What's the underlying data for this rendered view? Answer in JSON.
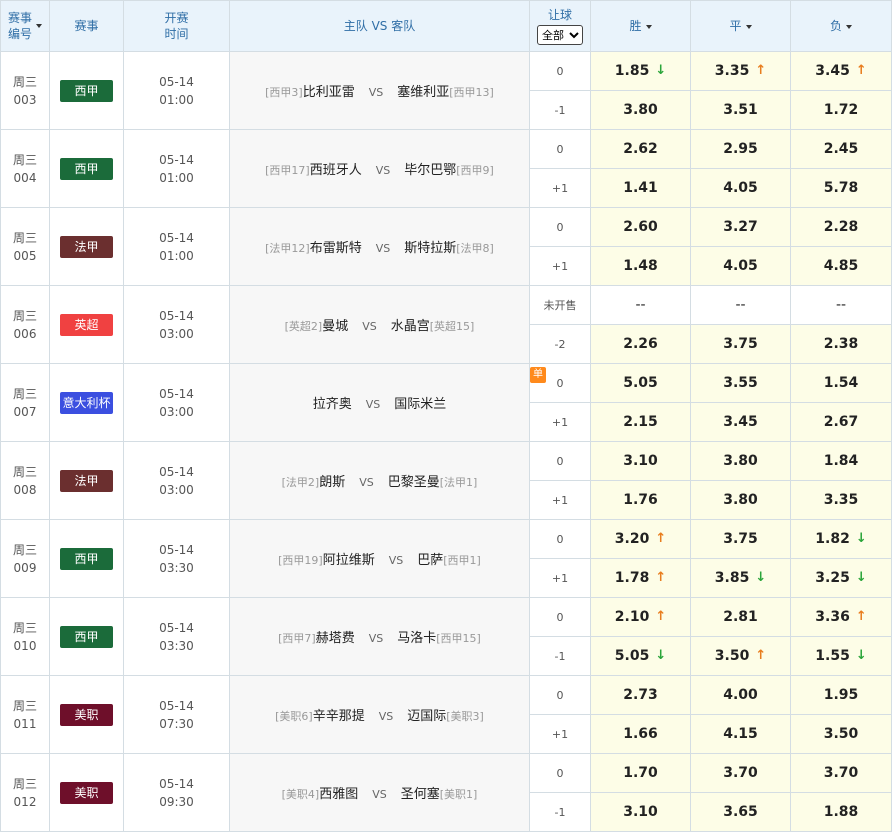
{
  "header": {
    "match_no": "赛事\n编号",
    "match_no_l1": "赛事",
    "match_no_l2": "编号",
    "league": "赛事",
    "time_l1": "开赛",
    "time_l2": "时间",
    "teams": "主队 VS 客队",
    "handicap_label": "让球",
    "handicap_select": "全部",
    "win": "胜",
    "draw": "平",
    "lose": "负"
  },
  "colors": {
    "西甲": "#1b6b3a",
    "法甲": "#6b2f2f",
    "英超": "#f04141",
    "意大利杯": "#3b4fe0",
    "美职": "#6e0f2a"
  },
  "matches": [
    {
      "weekday": "周三",
      "no": "003",
      "league": "西甲",
      "date": "05-14",
      "time": "01:00",
      "home_rank": "[西甲3]",
      "home": "比利亚雷",
      "vs": "VS",
      "away": "塞维利亚",
      "away_rank": "[西甲13]",
      "single": "",
      "rows": [
        {
          "hc": "0",
          "w": "1.85",
          "wa": "down",
          "d": "3.35",
          "da": "up",
          "l": "3.45",
          "la": "up"
        },
        {
          "hc": "-1",
          "w": "3.80",
          "wa": "",
          "d": "3.51",
          "da": "",
          "l": "1.72",
          "la": ""
        }
      ]
    },
    {
      "weekday": "周三",
      "no": "004",
      "league": "西甲",
      "date": "05-14",
      "time": "01:00",
      "home_rank": "[西甲17]",
      "home": "西班牙人",
      "vs": "VS",
      "away": "毕尔巴鄂",
      "away_rank": "[西甲9]",
      "single": "",
      "rows": [
        {
          "hc": "0",
          "w": "2.62",
          "wa": "",
          "d": "2.95",
          "da": "",
          "l": "2.45",
          "la": ""
        },
        {
          "hc": "+1",
          "w": "1.41",
          "wa": "",
          "d": "4.05",
          "da": "",
          "l": "5.78",
          "la": ""
        }
      ]
    },
    {
      "weekday": "周三",
      "no": "005",
      "league": "法甲",
      "date": "05-14",
      "time": "01:00",
      "home_rank": "[法甲12]",
      "home": "布雷斯特",
      "vs": "VS",
      "away": "斯特拉斯",
      "away_rank": "[法甲8]",
      "single": "",
      "rows": [
        {
          "hc": "0",
          "w": "2.60",
          "wa": "",
          "d": "3.27",
          "da": "",
          "l": "2.28",
          "la": ""
        },
        {
          "hc": "+1",
          "w": "1.48",
          "wa": "",
          "d": "4.05",
          "da": "",
          "l": "4.85",
          "la": ""
        }
      ]
    },
    {
      "weekday": "周三",
      "no": "006",
      "league": "英超",
      "date": "05-14",
      "time": "03:00",
      "home_rank": "[英超2]",
      "home": "曼城",
      "vs": "VS",
      "away": "水晶宫",
      "away_rank": "[英超15]",
      "single": "",
      "rows": [
        {
          "hc": "未开售",
          "w": "--",
          "wa": "",
          "d": "--",
          "da": "",
          "l": "--",
          "la": "",
          "blank": true
        },
        {
          "hc": "-2",
          "w": "2.26",
          "wa": "",
          "d": "3.75",
          "da": "",
          "l": "2.38",
          "la": ""
        }
      ]
    },
    {
      "weekday": "周三",
      "no": "007",
      "league": "意大利杯",
      "date": "05-14",
      "time": "03:00",
      "home_rank": "",
      "home": "拉齐奥",
      "vs": "VS",
      "away": "国际米兰",
      "away_rank": "",
      "single": "单",
      "rows": [
        {
          "hc": "0",
          "w": "5.05",
          "wa": "",
          "d": "3.55",
          "da": "",
          "l": "1.54",
          "la": ""
        },
        {
          "hc": "+1",
          "w": "2.15",
          "wa": "",
          "d": "3.45",
          "da": "",
          "l": "2.67",
          "la": ""
        }
      ]
    },
    {
      "weekday": "周三",
      "no": "008",
      "league": "法甲",
      "date": "05-14",
      "time": "03:00",
      "home_rank": "[法甲2]",
      "home": "朗斯",
      "vs": "VS",
      "away": "巴黎圣曼",
      "away_rank": "[法甲1]",
      "single": "",
      "rows": [
        {
          "hc": "0",
          "w": "3.10",
          "wa": "",
          "d": "3.80",
          "da": "",
          "l": "1.84",
          "la": ""
        },
        {
          "hc": "+1",
          "w": "1.76",
          "wa": "",
          "d": "3.80",
          "da": "",
          "l": "3.35",
          "la": ""
        }
      ]
    },
    {
      "weekday": "周三",
      "no": "009",
      "league": "西甲",
      "date": "05-14",
      "time": "03:30",
      "home_rank": "[西甲19]",
      "home": "阿拉维斯",
      "vs": "VS",
      "away": "巴萨",
      "away_rank": "[西甲1]",
      "single": "",
      "rows": [
        {
          "hc": "0",
          "w": "3.20",
          "wa": "up",
          "d": "3.75",
          "da": "",
          "l": "1.82",
          "la": "down"
        },
        {
          "hc": "+1",
          "w": "1.78",
          "wa": "up",
          "d": "3.85",
          "da": "down",
          "l": "3.25",
          "la": "down"
        }
      ]
    },
    {
      "weekday": "周三",
      "no": "010",
      "league": "西甲",
      "date": "05-14",
      "time": "03:30",
      "home_rank": "[西甲7]",
      "home": "赫塔费",
      "vs": "VS",
      "away": "马洛卡",
      "away_rank": "[西甲15]",
      "single": "",
      "rows": [
        {
          "hc": "0",
          "w": "2.10",
          "wa": "up",
          "d": "2.81",
          "da": "",
          "l": "3.36",
          "la": "up"
        },
        {
          "hc": "-1",
          "w": "5.05",
          "wa": "down",
          "d": "3.50",
          "da": "up",
          "l": "1.55",
          "la": "down"
        }
      ]
    },
    {
      "weekday": "周三",
      "no": "011",
      "league": "美职",
      "date": "05-14",
      "time": "07:30",
      "home_rank": "[美职6]",
      "home": "辛辛那提",
      "vs": "VS",
      "away": "迈国际",
      "away_rank": "[美职3]",
      "single": "",
      "rows": [
        {
          "hc": "0",
          "w": "2.73",
          "wa": "",
          "d": "4.00",
          "da": "",
          "l": "1.95",
          "la": ""
        },
        {
          "hc": "+1",
          "w": "1.66",
          "wa": "",
          "d": "4.15",
          "da": "",
          "l": "3.50",
          "la": ""
        }
      ]
    },
    {
      "weekday": "周三",
      "no": "012",
      "league": "美职",
      "date": "05-14",
      "time": "09:30",
      "home_rank": "[美职4]",
      "home": "西雅图",
      "vs": "VS",
      "away": "圣何塞",
      "away_rank": "[美职1]",
      "single": "",
      "rows": [
        {
          "hc": "0",
          "w": "1.70",
          "wa": "",
          "d": "3.70",
          "da": "",
          "l": "3.70",
          "la": ""
        },
        {
          "hc": "-1",
          "w": "3.10",
          "wa": "",
          "d": "3.65",
          "da": "",
          "l": "1.88",
          "la": ""
        }
      ]
    }
  ]
}
